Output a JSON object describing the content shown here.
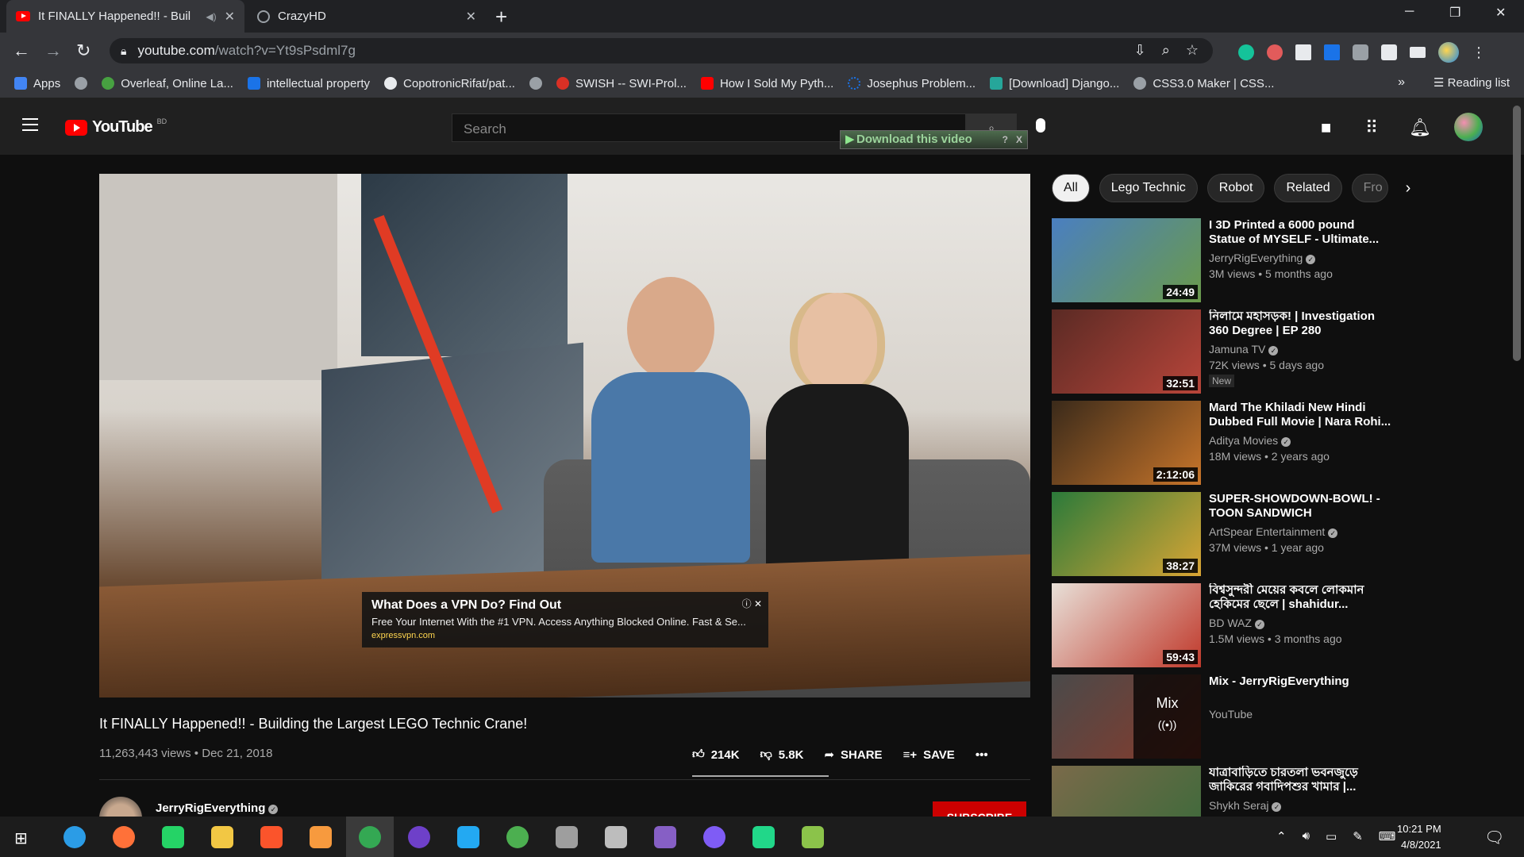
{
  "browser": {
    "tabs": [
      {
        "title": "It FINALLY Happened!! - Buil"
      },
      {
        "title": "CrazyHD"
      }
    ],
    "address": {
      "domain": "youtube.com",
      "path": "/watch?v=Yt9sPsdml7g"
    },
    "bookmarks": [
      {
        "label": "Apps",
        "color": "#4285f4"
      },
      {
        "label": "",
        "color": "#9aa0a6"
      },
      {
        "label": "Overleaf, Online La...",
        "color": "#47a141"
      },
      {
        "label": "intellectual property",
        "color": "#1a73e8"
      },
      {
        "label": "CopotronicRifat/pat...",
        "color": "#e8eaed"
      },
      {
        "label": "",
        "color": "#9aa0a6"
      },
      {
        "label": "SWISH -- SWI-Prol...",
        "color": "#d93025"
      },
      {
        "label": "How I Sold My Pyth...",
        "color": "#ff0000"
      },
      {
        "label": "Josephus Problem...",
        "color": "#1a73e8"
      },
      {
        "label": "[Download] Django...",
        "color": "#26a69a"
      },
      {
        "label": "CSS3.0 Maker | CSS...",
        "color": "#9aa0a6"
      }
    ],
    "reading_list": "Reading list"
  },
  "youtube": {
    "logo_text": "YouTube",
    "country": "BD",
    "search_placeholder": "Search",
    "downloader": "Download this video",
    "downloader_help": "?",
    "downloader_close": "X"
  },
  "video": {
    "title": "It FINALLY Happened!! - Building the Largest LEGO Technic Crane!",
    "views": "11,263,443 views",
    "date": "Dec 21, 2018",
    "likes": "214K",
    "dislikes": "5.8K",
    "share": "SHARE",
    "save": "SAVE",
    "channel": "JerryRigEverything",
    "subscribe": "SUBSCRIBE",
    "ad": {
      "title": "What Does a VPN Do? Find Out",
      "desc": "Free Your Internet With the #1 VPN. Access Anything Blocked Online. Fast & Se...",
      "url": "expressvpn.com"
    }
  },
  "chips": [
    "All",
    "Lego Technic",
    "Robot",
    "Related",
    "Fro"
  ],
  "recommendations": [
    {
      "title": "I 3D Printed a 6000 pound Statue of MYSELF - Ultimate...",
      "channel": "JerryRigEverything",
      "meta": "3M views • 5 months ago",
      "duration": "24:49",
      "colors": [
        "#4a7fc1",
        "#6a9a4a"
      ]
    },
    {
      "title": "নিলামে মহাসড়ক! | Investigation 360 Degree | EP 280",
      "channel": "Jamuna TV",
      "meta": "72K views • 5 days ago",
      "badge": "New",
      "duration": "32:51",
      "colors": [
        "#5a2a24",
        "#b8453a"
      ]
    },
    {
      "title": "Mard The Khiladi New Hindi Dubbed Full Movie | Nara Rohi...",
      "channel": "Aditya Movies",
      "meta": "18M views • 2 years ago",
      "duration": "2:12:06",
      "colors": [
        "#3a2a1a",
        "#c8752a"
      ]
    },
    {
      "title": "SUPER-SHOWDOWN-BOWL! - TOON SANDWICH",
      "channel": "ArtSpear Entertainment",
      "meta": "37M views • 1 year ago",
      "duration": "38:27",
      "colors": [
        "#2b7a3a",
        "#d9a534"
      ]
    },
    {
      "title": "বিশ্বসুন্দরী মেয়ের কবলে লোকমান হেকিমের ছেলে | shahidur...",
      "channel": "BD WAZ",
      "meta": "1.5M views • 3 months ago",
      "duration": "59:43",
      "colors": [
        "#e8e0d8",
        "#c0392b"
      ]
    },
    {
      "title": "Mix - JerryRigEverything",
      "channel": "YouTube",
      "meta": "",
      "duration": "",
      "mix": "Mix",
      "colors": [
        "#4a4a4a",
        "#8a3a2a"
      ]
    },
    {
      "title": "যাত্রাবাড়িতে চারতলা ভবনজুড়ে জাকিরের গবাদিপশুর খামার |...",
      "channel": "Shykh Seraj",
      "meta": "",
      "duration": "",
      "colors": [
        "#7a6a4a",
        "#3a6a3a"
      ]
    }
  ],
  "taskbar": {
    "time": "10:21 PM",
    "date": "4/8/2021",
    "apps": [
      {
        "name": "search",
        "color": "#2b9ce6"
      },
      {
        "name": "firefox",
        "color": "#ff7139"
      },
      {
        "name": "whatsapp",
        "color": "#25d366"
      },
      {
        "name": "explorer",
        "color": "#f2c744"
      },
      {
        "name": "brave",
        "color": "#fb542b"
      },
      {
        "name": "sublime",
        "color": "#f79a3e"
      },
      {
        "name": "chrome",
        "color": "#34a853"
      },
      {
        "name": "github",
        "color": "#6e40c9"
      },
      {
        "name": "vscode",
        "color": "#23a9f2"
      },
      {
        "name": "earth",
        "color": "#4caf50"
      },
      {
        "name": "chip",
        "color": "#9e9e9e"
      },
      {
        "name": "satellite",
        "color": "#bdbdbd"
      },
      {
        "name": "visualstudio",
        "color": "#865fc5"
      },
      {
        "name": "messenger",
        "color": "#7f5cf5"
      },
      {
        "name": "pycharm",
        "color": "#21d789"
      },
      {
        "name": "excel",
        "color": "#8bc34a"
      }
    ]
  }
}
